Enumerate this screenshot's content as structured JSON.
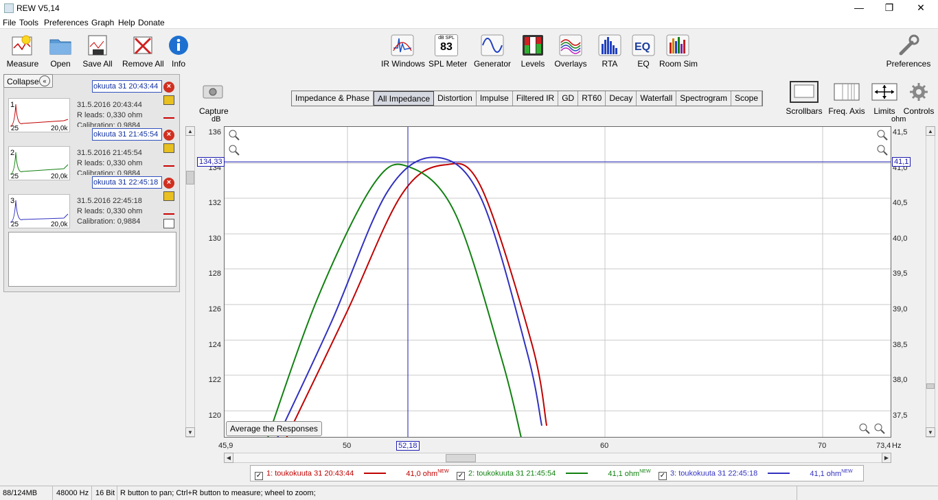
{
  "window": {
    "title": "REW V5,14",
    "minimize": "—",
    "maximize": "❐",
    "close": "✕"
  },
  "menu": [
    "File",
    "Tools",
    "Preferences",
    "Graph",
    "Help",
    "Donate"
  ],
  "toolbar_left": [
    "Measure",
    "Open",
    "Save All",
    "Remove All",
    "Info"
  ],
  "toolbar_center": [
    "IR Windows",
    "SPL Meter",
    "Generator",
    "Levels",
    "Overlays",
    "RTA",
    "EQ",
    "Room Sim"
  ],
  "spl_meter": {
    "unit": "dB SPL",
    "value": "83"
  },
  "toolbar_right": "Preferences",
  "collapse": "Collapse",
  "measurements": [
    {
      "num": "1",
      "name": "okuuta 31 20:43:44",
      "date": "31.5.2016 20:43:44",
      "leads": "R leads: 0,330 ohm",
      "cal": "Calibration: 0,9884",
      "tmin": "25",
      "tmax": "20,0k",
      "color": "#c00000"
    },
    {
      "num": "2",
      "name": "okuuta 31 21:45:54",
      "date": "31.5.2016 21:45:54",
      "leads": "R leads: 0,330 ohm",
      "cal": "Calibration: 0,9884",
      "tmin": "25",
      "tmax": "20,0k",
      "color": "#108010"
    },
    {
      "num": "3",
      "name": "okuuta 31 22:45:18",
      "date": "31.5.2016 22:45:18",
      "leads": "R leads: 0,330 ohm",
      "cal": "Calibration: 0,9884",
      "tmin": "25",
      "tmax": "20,0k",
      "color": "#3030c0"
    }
  ],
  "capture": "Capture",
  "tabs": [
    "Impedance & Phase",
    "All Impedance",
    "Distortion",
    "Impulse",
    "Filtered IR",
    "GD",
    "RT60",
    "Decay",
    "Waterfall",
    "Spectrogram",
    "Scope"
  ],
  "active_tab": "All Impedance",
  "right_tools": [
    "Scrollbars",
    "Freq. Axis",
    "Limits",
    "Controls"
  ],
  "plot": {
    "y_left_unit": "dB",
    "y_right_unit": "ohm",
    "x_unit": "Hz",
    "y_left_ticks": [
      "136",
      "134",
      "132",
      "130",
      "128",
      "126",
      "124",
      "122",
      "120"
    ],
    "y_right_ticks": [
      "41,5",
      "41,0",
      "40,5",
      "40,0",
      "39,5",
      "39,0",
      "38,5",
      "38,0",
      "37,5"
    ],
    "x_ticks": [
      "45,9",
      "50",
      "60",
      "70",
      "73,4"
    ],
    "cursor_y_left": "134,33",
    "cursor_y_right": "41,1",
    "cursor_x": "52,18",
    "average_button": "Average the Responses"
  },
  "chart_data": {
    "type": "line",
    "x_scale": "log",
    "xlim": [
      45.9,
      73.4
    ],
    "ylim_left": [
      119.0,
      136.2
    ],
    "ylim_right": [
      37.35,
      41.51
    ],
    "ylabel_left": "dB",
    "ylabel_right": "ohm",
    "xlabel": "Hz",
    "grid": true,
    "series": [
      {
        "name": "1: toukokuuta 31 20:43:44",
        "color": "#c00000",
        "peak_x": 53.6,
        "peak_ohm": 41.0,
        "x": [
          47.9,
          50.0,
          52.0,
          53.6,
          55.0,
          57.0,
          57.6
        ],
        "ohm": [
          37.3,
          39.0,
          40.6,
          41.0,
          40.7,
          38.6,
          37.5
        ]
      },
      {
        "name": "2: toukokuuta 31 21:45:54",
        "color": "#108010",
        "peak_x": 52.3,
        "peak_ohm": 40.97,
        "x": [
          47.2,
          49.0,
          51.0,
          52.3,
          54.0,
          55.8,
          56.6
        ],
        "ohm": [
          37.2,
          39.2,
          40.75,
          40.97,
          40.35,
          38.4,
          37.3
        ]
      },
      {
        "name": "3: toukokuuta 31 22:45:18",
        "color": "#3030c0",
        "peak_x": 53.3,
        "peak_ohm": 41.1,
        "x": [
          47.6,
          49.5,
          51.5,
          53.3,
          55.0,
          56.8,
          57.4
        ],
        "ohm": [
          37.3,
          38.9,
          40.65,
          41.1,
          40.55,
          38.5,
          37.5
        ]
      }
    ]
  },
  "legend": [
    {
      "label": "1: toukokuuta 31 20:43:44",
      "value": "41,0 ohm",
      "tag": "NEW",
      "color": "#c00000"
    },
    {
      "label": "2: toukokuuta 31 21:45:54",
      "value": "41,1 ohm",
      "tag": "NEW",
      "color": "#108010"
    },
    {
      "label": "3: toukokuuta 31 22:45:18",
      "value": "41,1 ohm",
      "tag": "NEW",
      "color": "#3030c0"
    }
  ],
  "status": {
    "memory": "88/124MB",
    "rate": "48000 Hz",
    "bits": "16 Bit",
    "hint": "R button to pan; Ctrl+R button to measure; wheel to zoom;"
  }
}
